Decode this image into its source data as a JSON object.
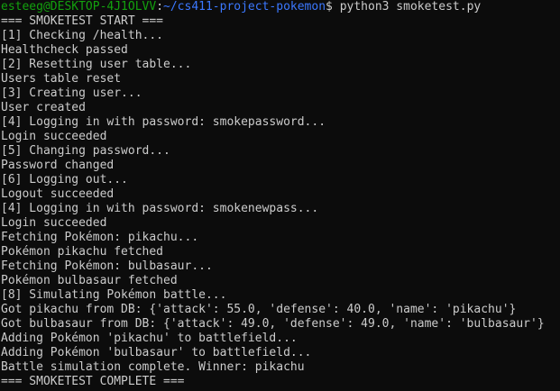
{
  "prompt": {
    "user_host": "esteeg@DESKTOP-4J1OLVV",
    "separator": ":",
    "path": "~/cs411-project-pokemon",
    "symbol": "$ ",
    "command": "python3 smoketest.py"
  },
  "output_lines": [
    "=== SMOKETEST START ===",
    "[1] Checking /health...",
    "Healthcheck passed",
    "[2] Resetting user table...",
    "Users table reset",
    "[3] Creating user...",
    "User created",
    "[4] Logging in with password: smokepassword...",
    "Login succeeded",
    "[5] Changing password...",
    "Password changed",
    "[6] Logging out...",
    "Logout succeeded",
    "[4] Logging in with password: smokenewpass...",
    "Login succeeded",
    "Fetching Pokémon: pikachu...",
    "Pokémon pikachu fetched",
    "Fetching Pokémon: bulbasaur...",
    "Pokémon bulbasaur fetched",
    "[8] Simulating Pokémon battle...",
    "Got pikachu from DB: {'attack': 55.0, 'defense': 40.0, 'name': 'pikachu'}",
    "Got bulbasaur from DB: {'attack': 49.0, 'defense': 49.0, 'name': 'bulbasaur'}",
    "Adding Pokémon 'pikachu' to battlefield...",
    "Adding Pokémon 'bulbasaur' to battlefield...",
    "Battle simulation complete. Winner: pikachu",
    "=== SMOKETEST COMPLETE ==="
  ],
  "colors": {
    "background": "#0c0c0c",
    "text": "#cccccc",
    "user_host": "#13a10e",
    "path": "#3b78ff"
  }
}
